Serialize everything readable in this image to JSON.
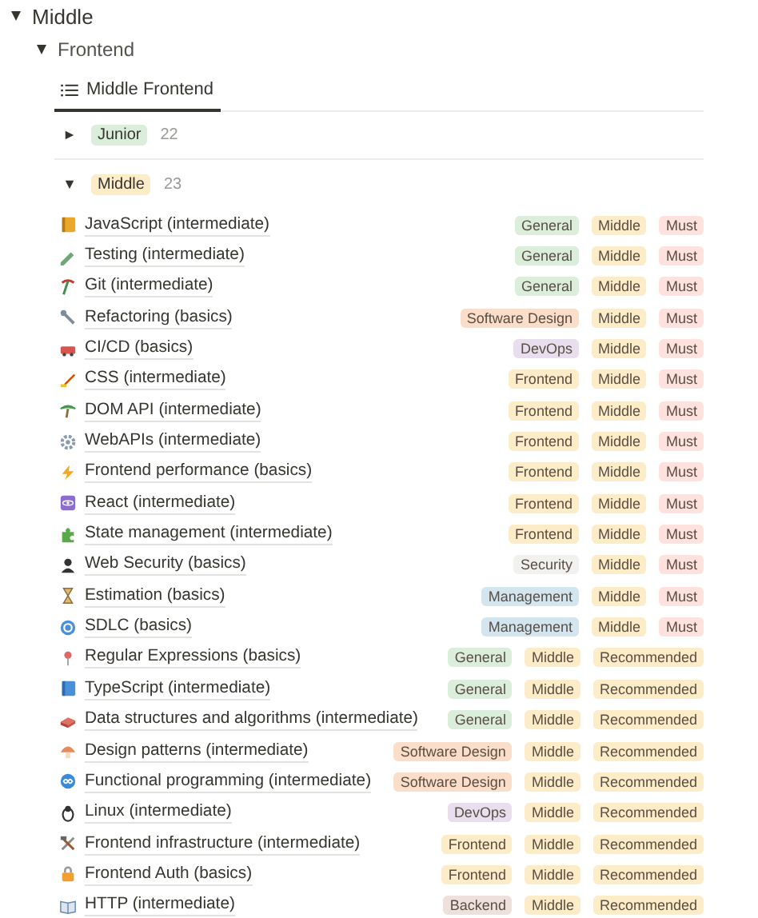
{
  "toggle": {
    "title": "Middle",
    "expanded": true
  },
  "subtoggle": {
    "title": "Frontend",
    "expanded": true
  },
  "view_tab": {
    "label": "Middle Frontend",
    "selected": true
  },
  "groups": [
    {
      "label": "Junior",
      "color": "#dbeddb",
      "count": "22",
      "expanded": false
    },
    {
      "label": "Middle",
      "color": "#fdecc8",
      "count": "23",
      "expanded": true,
      "items": [
        {
          "name": "JavaScript (intermediate)",
          "tags": [
            {
              "label": "General",
              "color": "#dbeddb"
            },
            {
              "label": "Middle",
              "color": "#fdecc8"
            },
            {
              "label": "Must",
              "color": "#ffe2dd"
            }
          ]
        },
        {
          "name": "Testing (intermediate)",
          "tags": [
            {
              "label": "General",
              "color": "#dbeddb"
            },
            {
              "label": "Middle",
              "color": "#fdecc8"
            },
            {
              "label": "Must",
              "color": "#ffe2dd"
            }
          ]
        },
        {
          "name": "Git (intermediate)",
          "tags": [
            {
              "label": "General",
              "color": "#dbeddb"
            },
            {
              "label": "Middle",
              "color": "#fdecc8"
            },
            {
              "label": "Must",
              "color": "#ffe2dd"
            }
          ]
        },
        {
          "name": "Refactoring (basics)",
          "tags": [
            {
              "label": "Software Design",
              "color": "#fadec9"
            },
            {
              "label": "Middle",
              "color": "#fdecc8"
            },
            {
              "label": "Must",
              "color": "#ffe2dd"
            }
          ]
        },
        {
          "name": "CI/CD (basics)",
          "tags": [
            {
              "label": "DevOps",
              "color": "#e8deee"
            },
            {
              "label": "Middle",
              "color": "#fdecc8"
            },
            {
              "label": "Must",
              "color": "#ffe2dd"
            }
          ]
        },
        {
          "name": "CSS (intermediate)",
          "tags": [
            {
              "label": "Frontend",
              "color": "#fdecc8"
            },
            {
              "label": "Middle",
              "color": "#fdecc8"
            },
            {
              "label": "Must",
              "color": "#ffe2dd"
            }
          ]
        },
        {
          "name": "DOM API (intermediate)",
          "tags": [
            {
              "label": "Frontend",
              "color": "#fdecc8"
            },
            {
              "label": "Middle",
              "color": "#fdecc8"
            },
            {
              "label": "Must",
              "color": "#ffe2dd"
            }
          ]
        },
        {
          "name": "WebAPIs (intermediate)",
          "tags": [
            {
              "label": "Frontend",
              "color": "#fdecc8"
            },
            {
              "label": "Middle",
              "color": "#fdecc8"
            },
            {
              "label": "Must",
              "color": "#ffe2dd"
            }
          ]
        },
        {
          "name": "Frontend performance (basics)",
          "tags": [
            {
              "label": "Frontend",
              "color": "#fdecc8"
            },
            {
              "label": "Middle",
              "color": "#fdecc8"
            },
            {
              "label": "Must",
              "color": "#ffe2dd"
            }
          ]
        },
        {
          "name": "React (intermediate)",
          "tags": [
            {
              "label": "Frontend",
              "color": "#fdecc8"
            },
            {
              "label": "Middle",
              "color": "#fdecc8"
            },
            {
              "label": "Must",
              "color": "#ffe2dd"
            }
          ]
        },
        {
          "name": "State management (intermediate)",
          "tags": [
            {
              "label": "Frontend",
              "color": "#fdecc8"
            },
            {
              "label": "Middle",
              "color": "#fdecc8"
            },
            {
              "label": "Must",
              "color": "#ffe2dd"
            }
          ]
        },
        {
          "name": "Web Security (basics)",
          "tags": [
            {
              "label": "Security",
              "color": "#f1f1ef"
            },
            {
              "label": "Middle",
              "color": "#fdecc8"
            },
            {
              "label": "Must",
              "color": "#ffe2dd"
            }
          ]
        },
        {
          "name": "Estimation (basics)",
          "tags": [
            {
              "label": "Management",
              "color": "#d3e5ef"
            },
            {
              "label": "Middle",
              "color": "#fdecc8"
            },
            {
              "label": "Must",
              "color": "#ffe2dd"
            }
          ]
        },
        {
          "name": "SDLC (basics)",
          "tags": [
            {
              "label": "Management",
              "color": "#d3e5ef"
            },
            {
              "label": "Middle",
              "color": "#fdecc8"
            },
            {
              "label": "Must",
              "color": "#ffe2dd"
            }
          ]
        },
        {
          "name": "Regular Expressions (basics)",
          "tags": [
            {
              "label": "General",
              "color": "#dbeddb"
            },
            {
              "label": "Middle",
              "color": "#fdecc8"
            },
            {
              "label": "Recommended",
              "color": "#fdecc8"
            }
          ]
        },
        {
          "name": "TypeScript (intermediate)",
          "tags": [
            {
              "label": "General",
              "color": "#dbeddb"
            },
            {
              "label": "Middle",
              "color": "#fdecc8"
            },
            {
              "label": "Recommended",
              "color": "#fdecc8"
            }
          ]
        },
        {
          "name": "Data structures and algorithms (intermediate)",
          "tags": [
            {
              "label": "General",
              "color": "#dbeddb"
            },
            {
              "label": "Middle",
              "color": "#fdecc8"
            },
            {
              "label": "Recommended",
              "color": "#fdecc8"
            }
          ]
        },
        {
          "name": "Design patterns (intermediate)",
          "tags": [
            {
              "label": "Software Design",
              "color": "#fadec9"
            },
            {
              "label": "Middle",
              "color": "#fdecc8"
            },
            {
              "label": "Recommended",
              "color": "#fdecc8"
            }
          ]
        },
        {
          "name": "Functional programming (intermediate)",
          "tags": [
            {
              "label": "Software Design",
              "color": "#fadec9"
            },
            {
              "label": "Middle",
              "color": "#fdecc8"
            },
            {
              "label": "Recommended",
              "color": "#fdecc8"
            }
          ]
        },
        {
          "name": "Linux (intermediate)",
          "tags": [
            {
              "label": "DevOps",
              "color": "#e8deee"
            },
            {
              "label": "Middle",
              "color": "#fdecc8"
            },
            {
              "label": "Recommended",
              "color": "#fdecc8"
            }
          ]
        },
        {
          "name": "Frontend infrastructure (intermediate)",
          "tags": [
            {
              "label": "Frontend",
              "color": "#fdecc8"
            },
            {
              "label": "Middle",
              "color": "#fdecc8"
            },
            {
              "label": "Recommended",
              "color": "#fdecc8"
            }
          ]
        },
        {
          "name": "Frontend Auth (basics)",
          "tags": [
            {
              "label": "Frontend",
              "color": "#fdecc8"
            },
            {
              "label": "Middle",
              "color": "#fdecc8"
            },
            {
              "label": "Recommended",
              "color": "#fdecc8"
            }
          ]
        },
        {
          "name": "HTTP (intermediate)",
          "tags": [
            {
              "label": "Backend",
              "color": "#eee0da"
            },
            {
              "label": "Middle",
              "color": "#fdecc8"
            },
            {
              "label": "Recommended",
              "color": "#fdecc8"
            }
          ]
        }
      ]
    }
  ]
}
